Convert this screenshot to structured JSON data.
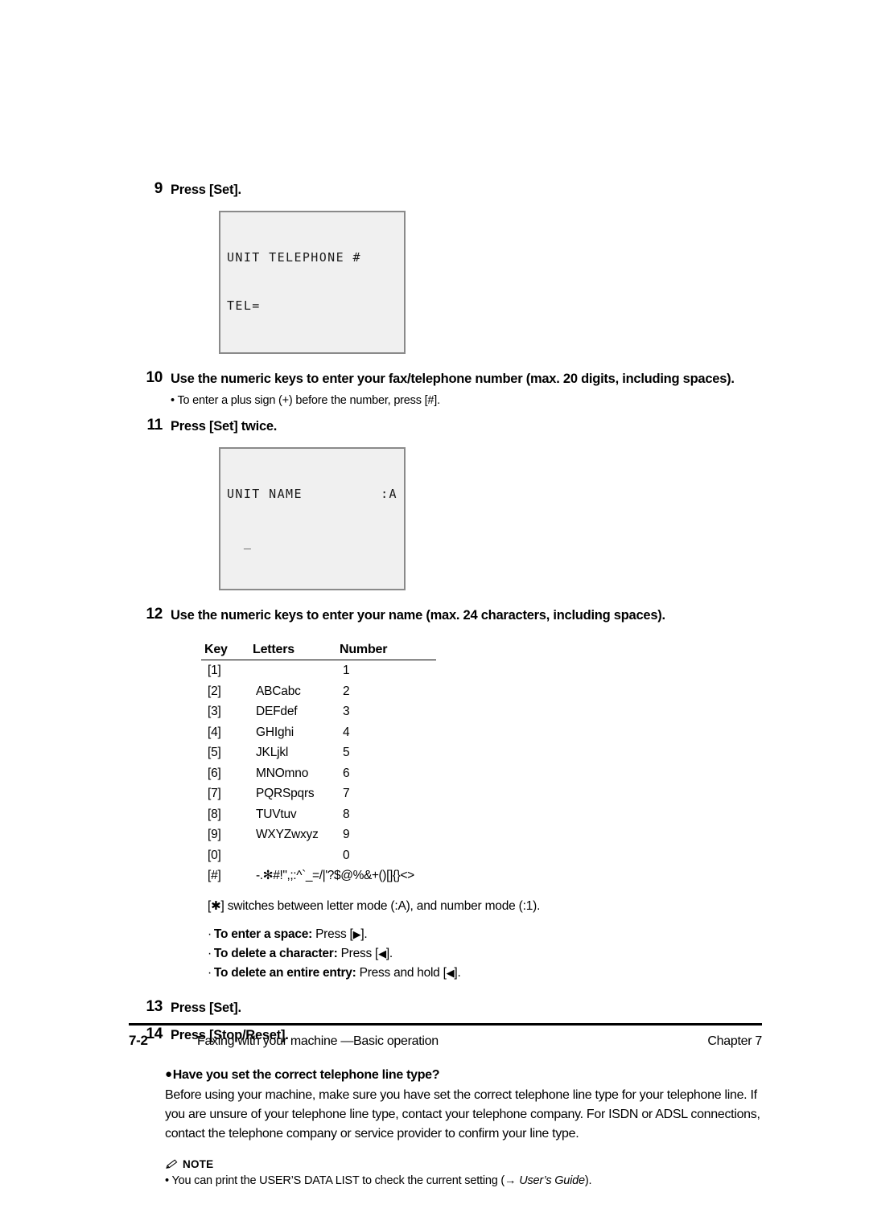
{
  "document": {
    "page_label": "7-2",
    "footer_title": "Faxing with your machine —Basic operation",
    "footer_chapter": "Chapter 7"
  },
  "steps": {
    "s9": {
      "num": "9",
      "text": "Press [Set]."
    },
    "s10": {
      "num": "10",
      "text": "Use the numeric keys to enter your fax/telephone number (max. 20 digits, including spaces).",
      "sub": "• To enter a plus sign (+) before the number, press [#]."
    },
    "s11": {
      "num": "11",
      "text": "Press [Set] twice."
    },
    "s12": {
      "num": "12",
      "text": "Use the numeric keys to enter your name (max. 24 characters, including spaces)."
    },
    "s13": {
      "num": "13",
      "text": "Press [Set]."
    },
    "s14": {
      "num": "14",
      "text": "Press [Stop/Reset]."
    }
  },
  "lcd1": {
    "line1": "UNIT TELEPHONE #",
    "line2": "TEL="
  },
  "lcd2": {
    "line1_left": "UNIT NAME",
    "line1_right": ":A",
    "line2": "  _"
  },
  "key_table": {
    "headers": {
      "key": "Key",
      "letters": "Letters",
      "number": "Number"
    },
    "rows": [
      {
        "key": "[1]",
        "letters": "",
        "number": "1"
      },
      {
        "key": "[2]",
        "letters": "ABCabc",
        "number": "2"
      },
      {
        "key": "[3]",
        "letters": "DEFdef",
        "number": "3"
      },
      {
        "key": "[4]",
        "letters": "GHIghi",
        "number": "4"
      },
      {
        "key": "[5]",
        "letters": "JKLjkl",
        "number": "5"
      },
      {
        "key": "[6]",
        "letters": "MNOmno",
        "number": "6"
      },
      {
        "key": "[7]",
        "letters": "PQRSpqrs",
        "number": "7"
      },
      {
        "key": "[8]",
        "letters": "TUVtuv",
        "number": "8"
      },
      {
        "key": "[9]",
        "letters": "WXYZwxyz",
        "number": "9"
      },
      {
        "key": "[0]",
        "letters": "",
        "number": "0"
      }
    ],
    "symbol_row": {
      "key": "[#]",
      "letters": "-.✻#!\",;:^`_=/|'?$@%&+()[]{}<>",
      "number": ""
    }
  },
  "mode_note": {
    "prefix": "[",
    "star": "✱",
    "suffix": "] switches between letter mode (:A), and number mode (:1)."
  },
  "key_hints": [
    {
      "dot": "·",
      "label": "To enter a space:",
      "pre": " Press [",
      "glyph": "▶",
      "post": "]."
    },
    {
      "dot": "·",
      "label": "To delete a character:",
      "pre": " Press [",
      "glyph": "◀",
      "post": "]."
    },
    {
      "dot": "·",
      "label": "To delete an entire entry:",
      "pre": " Press and hold [",
      "glyph": "◀",
      "post": "]."
    }
  ],
  "line_type_section": {
    "bullet": "●",
    "heading": "Have you set the correct telephone line type?",
    "body": "Before using your machine, make sure you have set the correct telephone line type for your telephone line. If you are unsure of your telephone line type, contact your telephone company. For ISDN or ADSL connections, contact the telephone company or service provider to confirm your line type."
  },
  "note": {
    "label": "NOTE",
    "body_pre": "• You can print the USER’S DATA LIST to check the current setting (→ ",
    "body_italic": "User’s Guide",
    "body_post": ")."
  },
  "colors": {
    "text": "#000000",
    "lcd_bg": "#f0f0f0",
    "lcd_border": "#8a8a8a",
    "rule": "#000000"
  }
}
